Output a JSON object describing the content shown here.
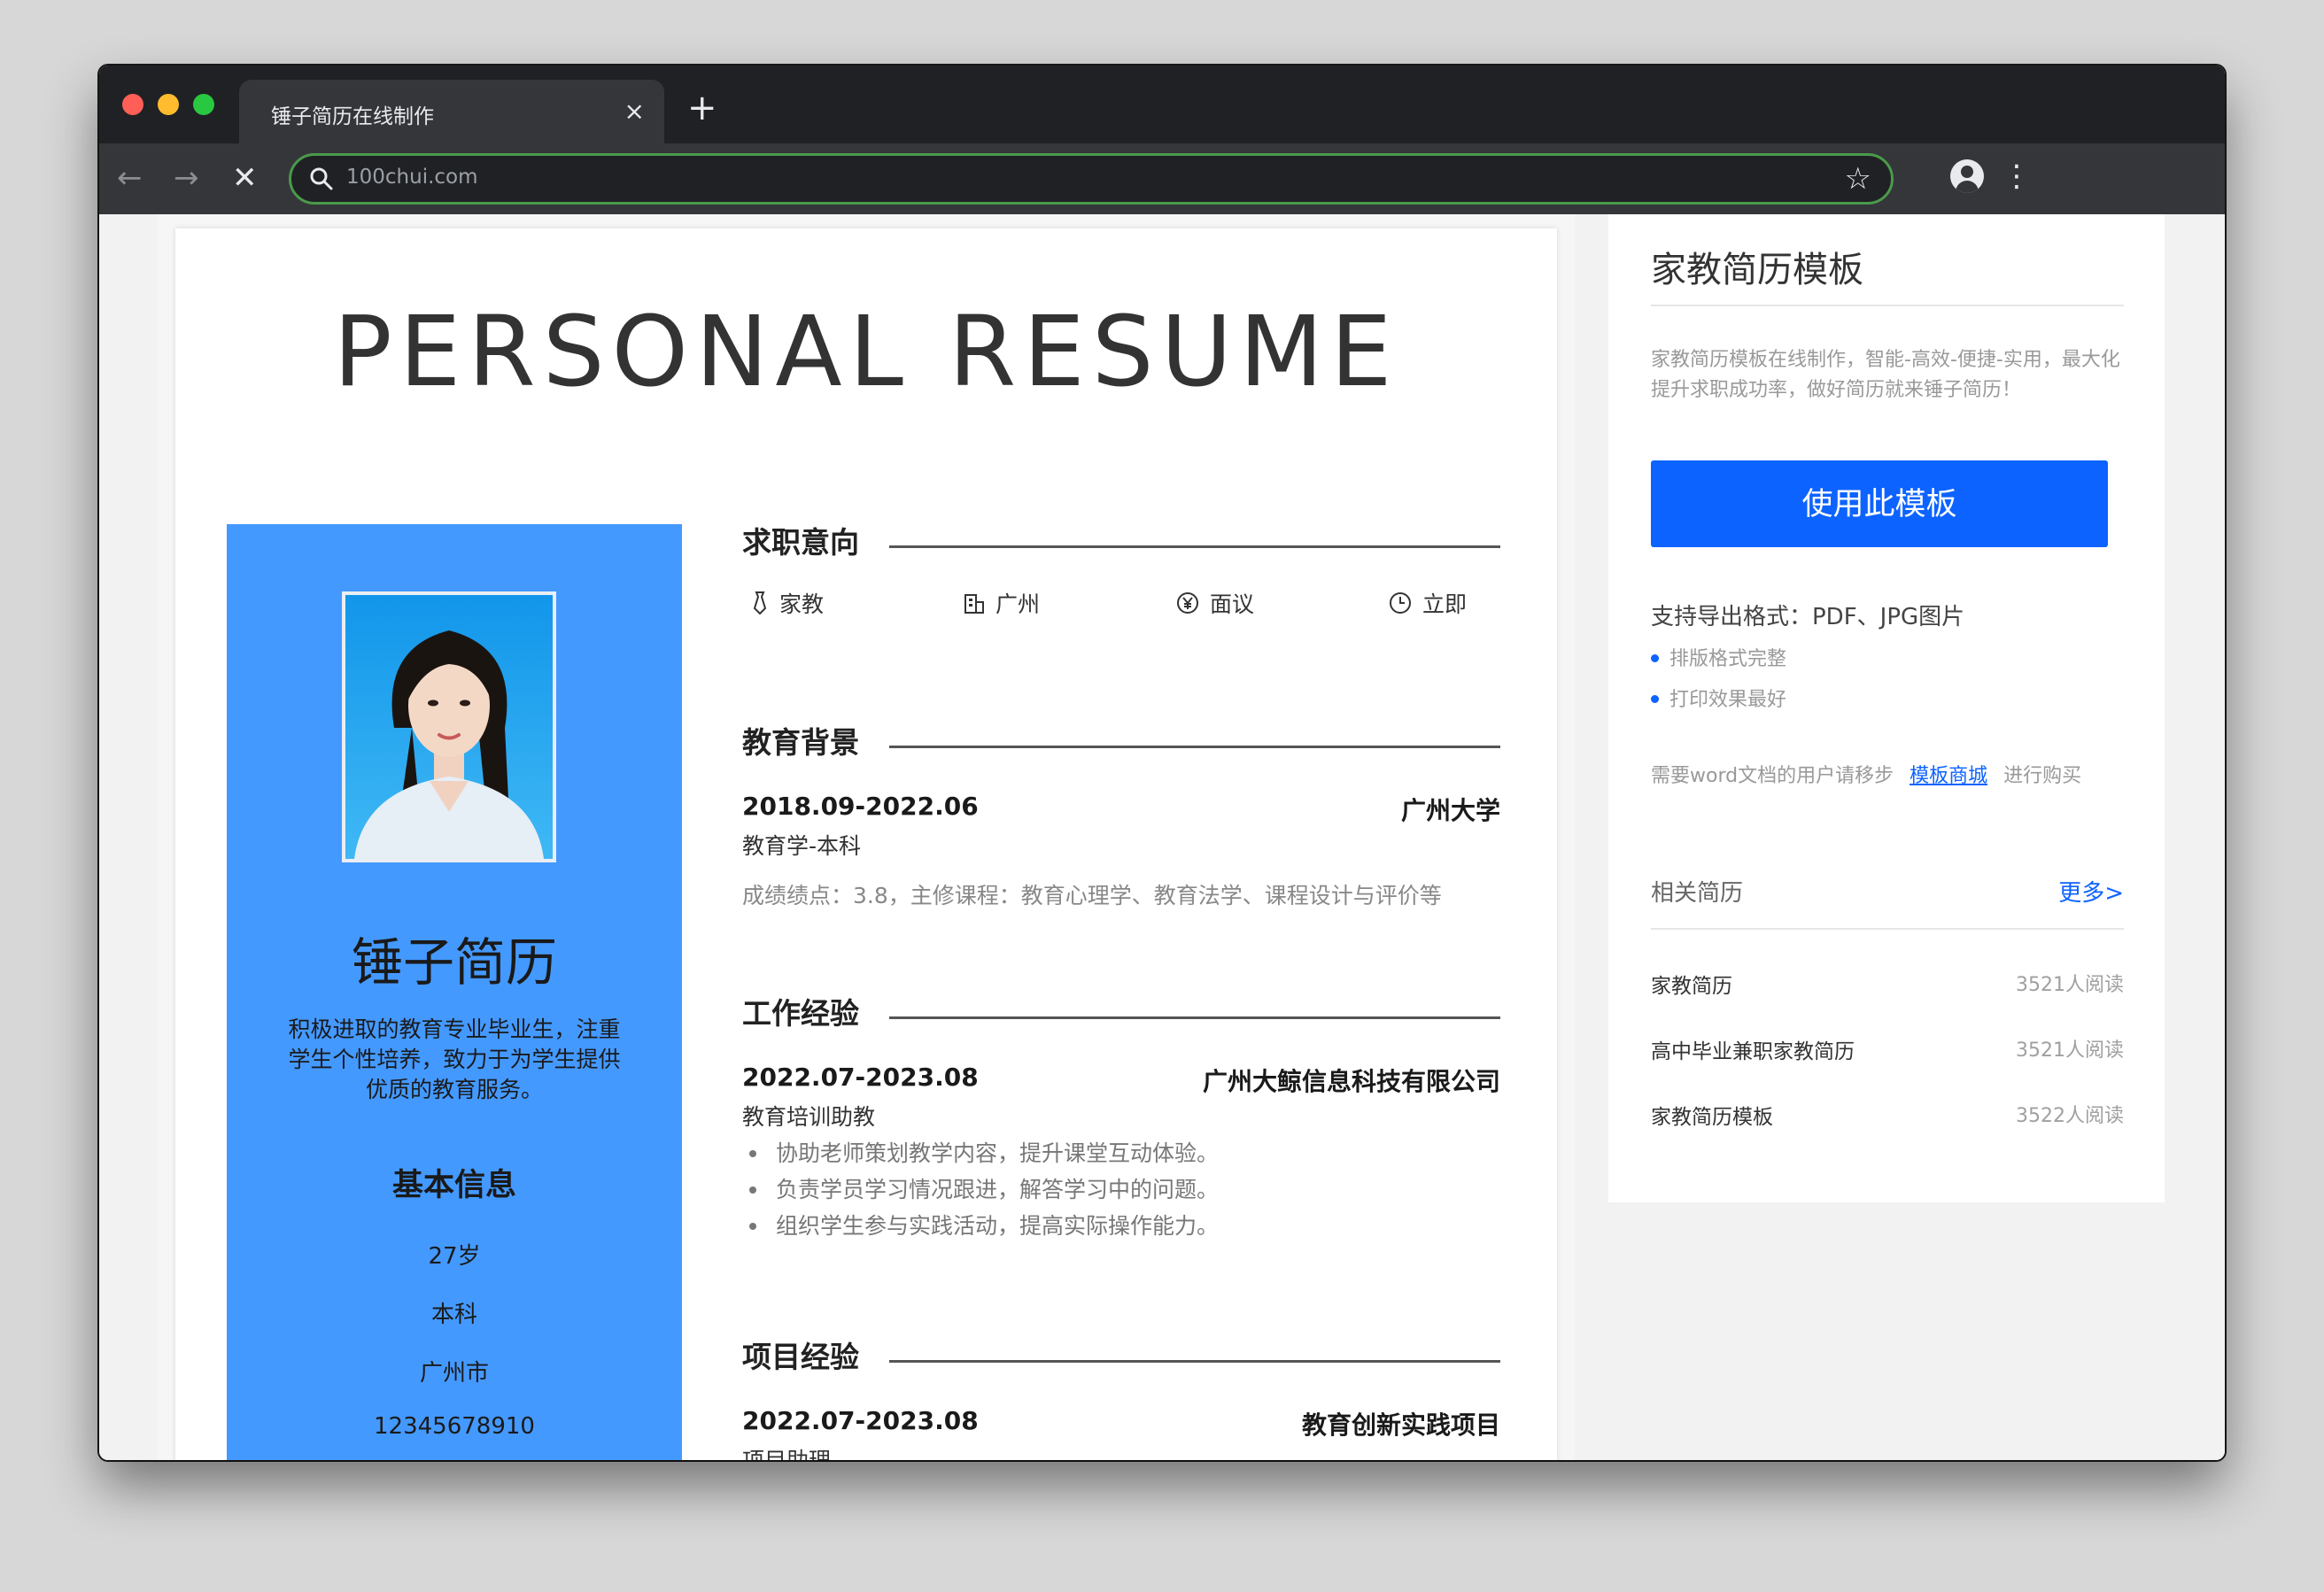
{
  "browser": {
    "tab_title": "锤子简历在线制作",
    "tab_close": "×",
    "new_tab": "+",
    "url": "100chui.com",
    "back": "←",
    "forward": "→",
    "stop": "✕",
    "bookmark": "☆",
    "menu": "⋮"
  },
  "resume": {
    "title": "PERSONAL RESUME",
    "name": "锤子简历",
    "intro": "积极进取的教育专业毕业生，注重学生个性培养，致力于为学生提供优质的教育服务。",
    "basic_info": {
      "title": "基本信息",
      "items": [
        "27岁",
        "本科",
        "广州市",
        "12345678910"
      ]
    },
    "job_intent": {
      "title": "求职意向",
      "items": [
        {
          "icon": "tie-icon",
          "label": "家教"
        },
        {
          "icon": "building-icon",
          "label": "广州"
        },
        {
          "icon": "yuan-icon",
          "label": "面议"
        },
        {
          "icon": "clock-icon",
          "label": "立即"
        }
      ]
    },
    "education": {
      "title": "教育背景",
      "date": "2018.09-2022.06",
      "school": "广州大学",
      "major": "教育学-本科",
      "note": "成绩绩点：3.8，主修课程：教育心理学、教育法学、课程设计与评价等"
    },
    "work": {
      "title": "工作经验",
      "date": "2022.07-2023.08",
      "company": "广州大鲸信息科技有限公司",
      "role": "教育培训助教",
      "bullets": [
        "协助老师策划教学内容，提升课堂互动体验。",
        "负责学员学习情况跟进，解答学习中的问题。",
        "组织学生参与实践活动，提高实际操作能力。"
      ]
    },
    "project": {
      "title": "项目经验",
      "date": "2022.07-2023.08",
      "name": "教育创新实践项目",
      "role": "项目助理"
    }
  },
  "sidebar": {
    "title": "家教简历模板",
    "desc": "家教简历模板在线制作，智能-高效-便捷-实用，最大化提升求职成功率，做好简历就来锤子简历！",
    "use_button": "使用此模板",
    "export": "支持导出格式：PDF、JPG图片",
    "features": [
      "排版格式完整",
      "打印效果最好"
    ],
    "word_prefix": "需要word文档的用户请移步",
    "word_link": "模板商城",
    "word_suffix": "进行购买",
    "related_title": "相关简历",
    "more": "更多>",
    "related": [
      {
        "name": "家教简历",
        "count": "3521人阅读"
      },
      {
        "name": "高中毕业兼职家教简历",
        "count": "3521人阅读"
      },
      {
        "name": "家教简历模板",
        "count": "3522人阅读"
      }
    ],
    "accent_color": "#0d63ff"
  },
  "theme": {
    "resume_side_color": "#4499ff"
  }
}
